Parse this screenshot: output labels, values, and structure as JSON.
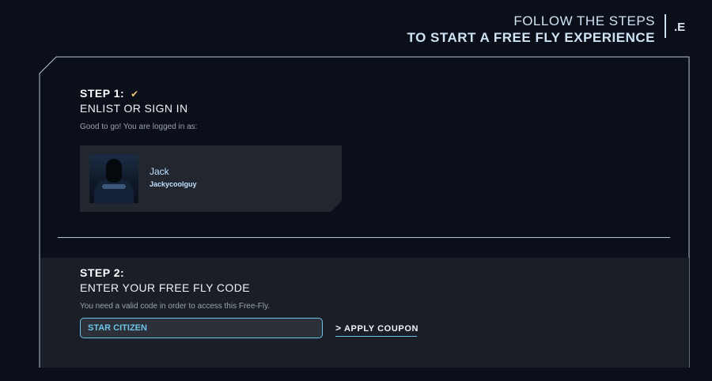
{
  "header": {
    "line1": "FOLLOW THE STEPS",
    "line2": "TO START A FREE FLY EXPERIENCE",
    "logo": ".E"
  },
  "step1": {
    "title": "STEP 1:",
    "subtitle": "ENLIST OR SIGN IN",
    "note": "Good to go! You are logged in as:",
    "check_icon": "checkmark-icon"
  },
  "user": {
    "name": "Jack",
    "handle": "Jackycoolguy"
  },
  "step2": {
    "title": "STEP 2:",
    "subtitle": "ENTER YOUR FREE FLY CODE",
    "note": "You need a valid code in order to access this Free-Fly.",
    "code_value": "STAR CITIZEN",
    "apply_label": "APPLY COUPON"
  },
  "colors": {
    "background": "#0b0f19",
    "accent": "#6fc3e8",
    "check": "#e8c56b"
  }
}
